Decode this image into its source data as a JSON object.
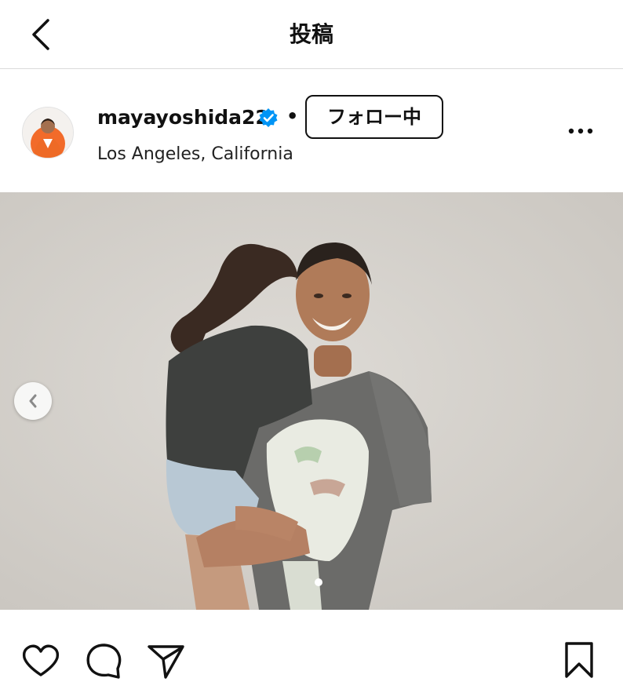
{
  "header": {
    "title": "投稿",
    "back_icon": "chevron-left-icon"
  },
  "post": {
    "username": "mayayoshida22",
    "verified": true,
    "separator": "•",
    "follow_label": "フォロー中",
    "location": "Los Angeles, California",
    "more_icon": "more-horizontal-icon",
    "carousel": {
      "current_index": 2,
      "dots_visible": 1
    }
  },
  "actions": {
    "like_icon": "heart-icon",
    "comment_icon": "comment-icon",
    "share_icon": "send-icon",
    "save_icon": "bookmark-icon"
  },
  "colors": {
    "verified_badge": "#0095f6",
    "divider": "#dbdbdb",
    "text": "#111111"
  }
}
